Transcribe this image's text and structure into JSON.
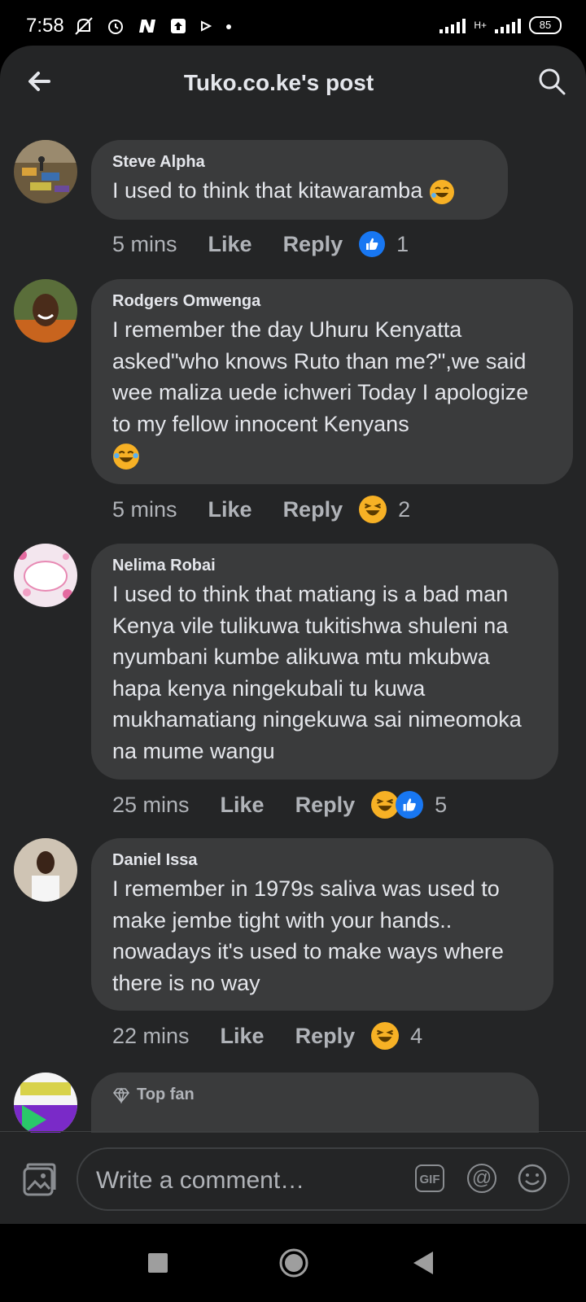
{
  "status_bar": {
    "time": "7:58",
    "network": "H+",
    "battery": "85"
  },
  "header": {
    "title": "Tuko.co.ke's post"
  },
  "actions": {
    "like_label": "Like",
    "reply_label": "Reply"
  },
  "comments": [
    {
      "author": "Steve Alpha",
      "text": "I used to think that kitawaramba",
      "time": "5 mins",
      "reactions": [
        "like"
      ],
      "reaction_count": "1"
    },
    {
      "author": "Rodgers Omwenga",
      "text": "I remember the day Uhuru Kenyatta asked\"who knows Ruto than me?\",we said wee maliza uede ichweri Today I apologize to my fellow innocent Kenyans",
      "time": "5 mins",
      "reactions": [
        "haha"
      ],
      "reaction_count": "2"
    },
    {
      "author": "Nelima Robai",
      "text": "I used to think that matiang is a bad man Kenya vile tulikuwa tukitishwa shuleni na nyumbani kumbe alikuwa mtu mkubwa hapa kenya ningekubali tu kuwa mukhamatiang ningekuwa sai nimeomoka na mume wangu",
      "time": "25 mins",
      "reactions": [
        "haha",
        "like"
      ],
      "reaction_count": "5"
    },
    {
      "author": "Daniel Issa",
      "text": "I remember in 1979s saliva was used to make jembe tight with your hands.. nowadays it's used to make ways where there is no way",
      "time": "22 mins",
      "reactions": [
        "haha"
      ],
      "reaction_count": "4"
    },
    {
      "badge": "Top fan"
    }
  ],
  "composer": {
    "placeholder": "Write a comment…",
    "gif_label": "GIF",
    "at_label": "@"
  },
  "colors": {
    "background": "#242526",
    "bubble": "#3a3b3c",
    "like_blue": "#1877f2",
    "haha_yellow": "#f7b125",
    "text": "#e4e6eb",
    "muted": "#b0b3b8"
  }
}
